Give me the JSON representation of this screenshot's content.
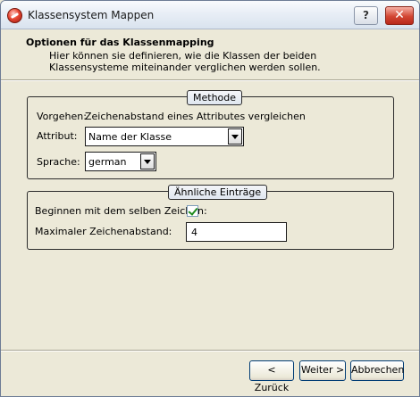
{
  "window": {
    "title": "Klassensystem Mappen",
    "help_glyph": "?",
    "close_glyph": "✕"
  },
  "header": {
    "title": "Optionen für das Klassenmapping",
    "description": "Hier können sie definieren, wie die Klassen der beiden Klassensysteme miteinander verglichen werden sollen."
  },
  "methode": {
    "legend": "Methode",
    "vorgehen_label": "Vorgehen:",
    "vorgehen_value": "Zeichenabstand eines Attributes vergleichen",
    "attribut_label": "Attribut:",
    "attribut_value": "Name der Klasse",
    "sprache_label": "Sprache:",
    "sprache_value": "german"
  },
  "aehnliche": {
    "legend": "Ähnliche Einträge",
    "beginnen_label": "Beginnen mit dem selben Zeichen:",
    "beginnen_checked": true,
    "abstand_label": "Maximaler Zeichenabstand:",
    "abstand_value": "4"
  },
  "buttons": {
    "back": "< Zurück",
    "next": "Weiter >",
    "cancel": "Abbrechen"
  }
}
